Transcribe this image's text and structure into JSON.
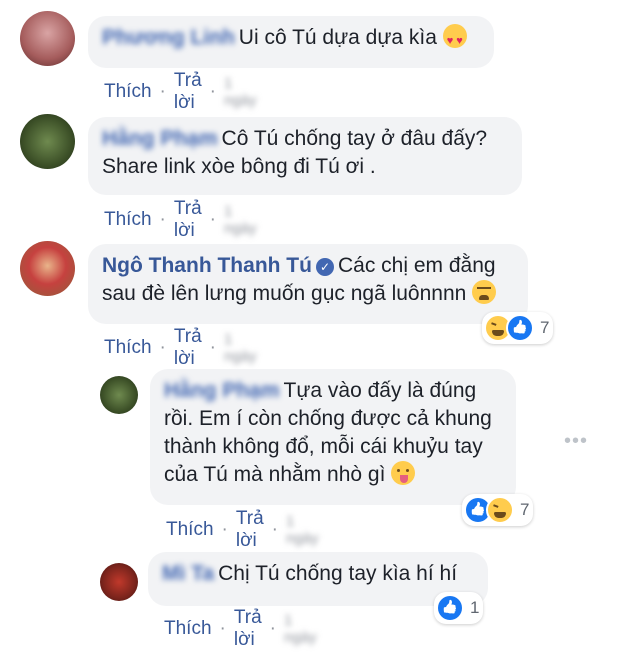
{
  "comments": [
    {
      "name": "Phương Linh",
      "text": "Ui cô Tú dựa dựa kìa",
      "like": "Thích",
      "reply": "Trả lời",
      "time": "1 ngày"
    },
    {
      "name": "Hằng Phạm",
      "text1": "Cô Tú chống tay ở đâu đấy?",
      "text2": "Share link xòe bông đi Tú ơi .",
      "like": "Thích",
      "reply": "Trả lời",
      "time": "1 ngày"
    },
    {
      "name": "Ngô Thanh Thanh Tú",
      "text1": "Các chị em đằng",
      "text2": "sau đè lên lưng muốn gục ngã luônnnn",
      "like": "Thích",
      "reply": "Trả lời",
      "time": "1 ngày",
      "reaction_count": "7"
    },
    {
      "name": "Hằng Phạm",
      "text1": "Tựa vào đấy là đúng",
      "text2": "rồi. Em í còn chống được cả khung",
      "text3": "thành không đổ, mỗi cái khuỷu tay",
      "text4": "của Tú mà nhằm nhò gì",
      "like": "Thích",
      "reply": "Trả lời",
      "time": "1 ngày",
      "reaction_count": "7"
    },
    {
      "name": "Mì Ta",
      "text": "Chị Tú chống tay kìa hí hí",
      "like": "Thích",
      "reply": "Trả lời",
      "time": "1 ngày",
      "reaction_count": "1"
    }
  ],
  "icons": {
    "verified": "verified-badge-icon",
    "like_reaction": "like-reaction-icon",
    "haha_reaction": "haha-reaction-icon",
    "more": "more-options-icon"
  },
  "colors": {
    "link": "#385898",
    "bubble": "#f2f3f5",
    "like_blue": "#1877f2"
  }
}
